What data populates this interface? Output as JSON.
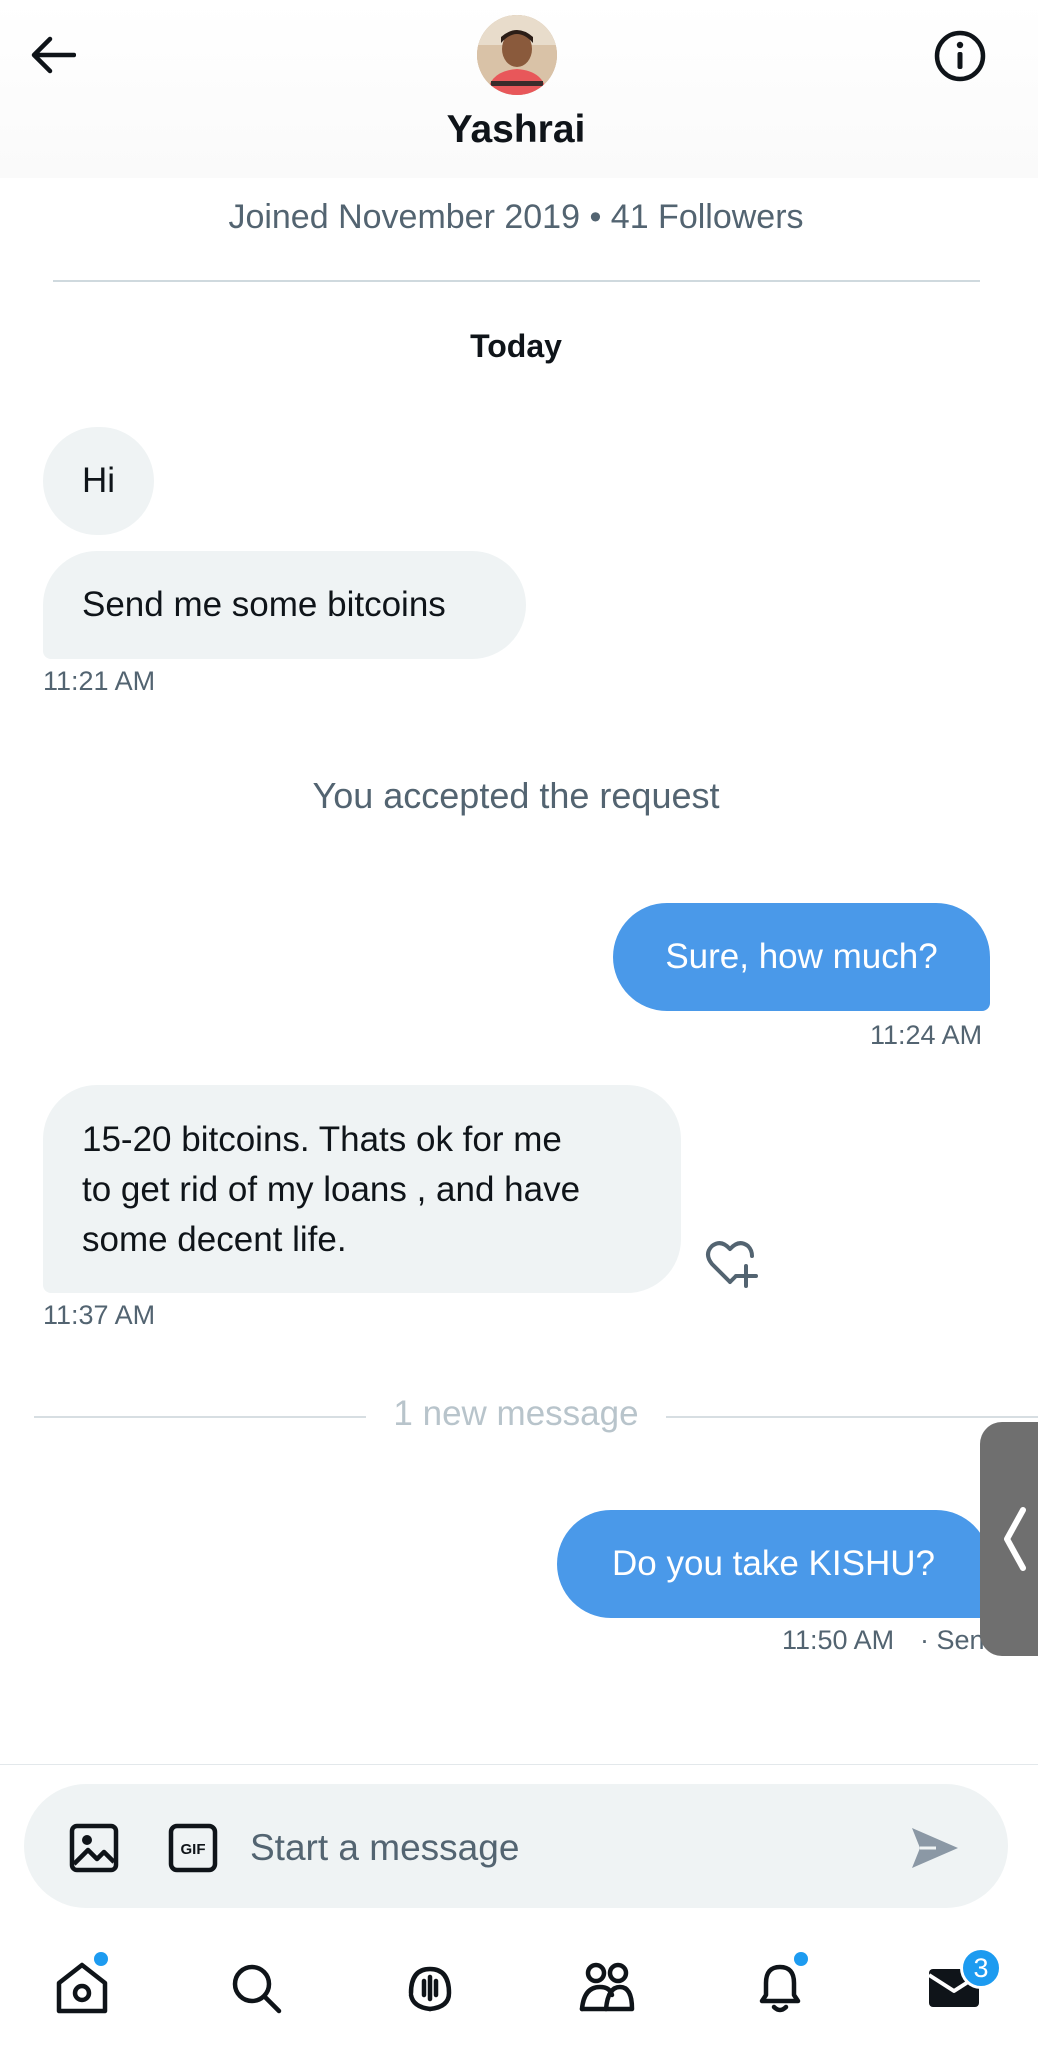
{
  "header": {
    "name": "Yashrai"
  },
  "profile": {
    "meta": "Joined November 2019 • 41 Followers"
  },
  "day_label": "Today",
  "messages": [
    {
      "text": "Hi"
    },
    {
      "text": "Send me some bitcoins",
      "time": "11:21 AM"
    },
    {
      "text": "Sure, how much?",
      "time": "11:24 AM"
    },
    {
      "line1": "15-20 bitcoins. Thats ok for me",
      "line2": "to get rid of my loans , and have",
      "line3": "some decent life.",
      "time": "11:37 AM"
    },
    {
      "text": "Do you take KISHU?",
      "time": "11:50 AM",
      "status": "· Sent"
    }
  ],
  "system_text": "You accepted the request",
  "new_message_divider": "1 new message",
  "composer": {
    "placeholder": "Start a message",
    "gif_label": "GIF"
  },
  "nav": {
    "messages_badge": "3"
  },
  "colors": {
    "accent": "#1d9bf0",
    "outgoing_bubble": "#4a99e9",
    "incoming_bubble": "#eff3f4",
    "secondary_text": "#536471"
  },
  "icons": [
    "back-arrow-icon",
    "info-icon",
    "heart-plus-icon",
    "image-icon",
    "gif-icon",
    "send-icon",
    "home-icon",
    "search-icon",
    "spaces-icon",
    "communities-icon",
    "bell-icon",
    "mail-icon",
    "chevron-left-icon"
  ]
}
